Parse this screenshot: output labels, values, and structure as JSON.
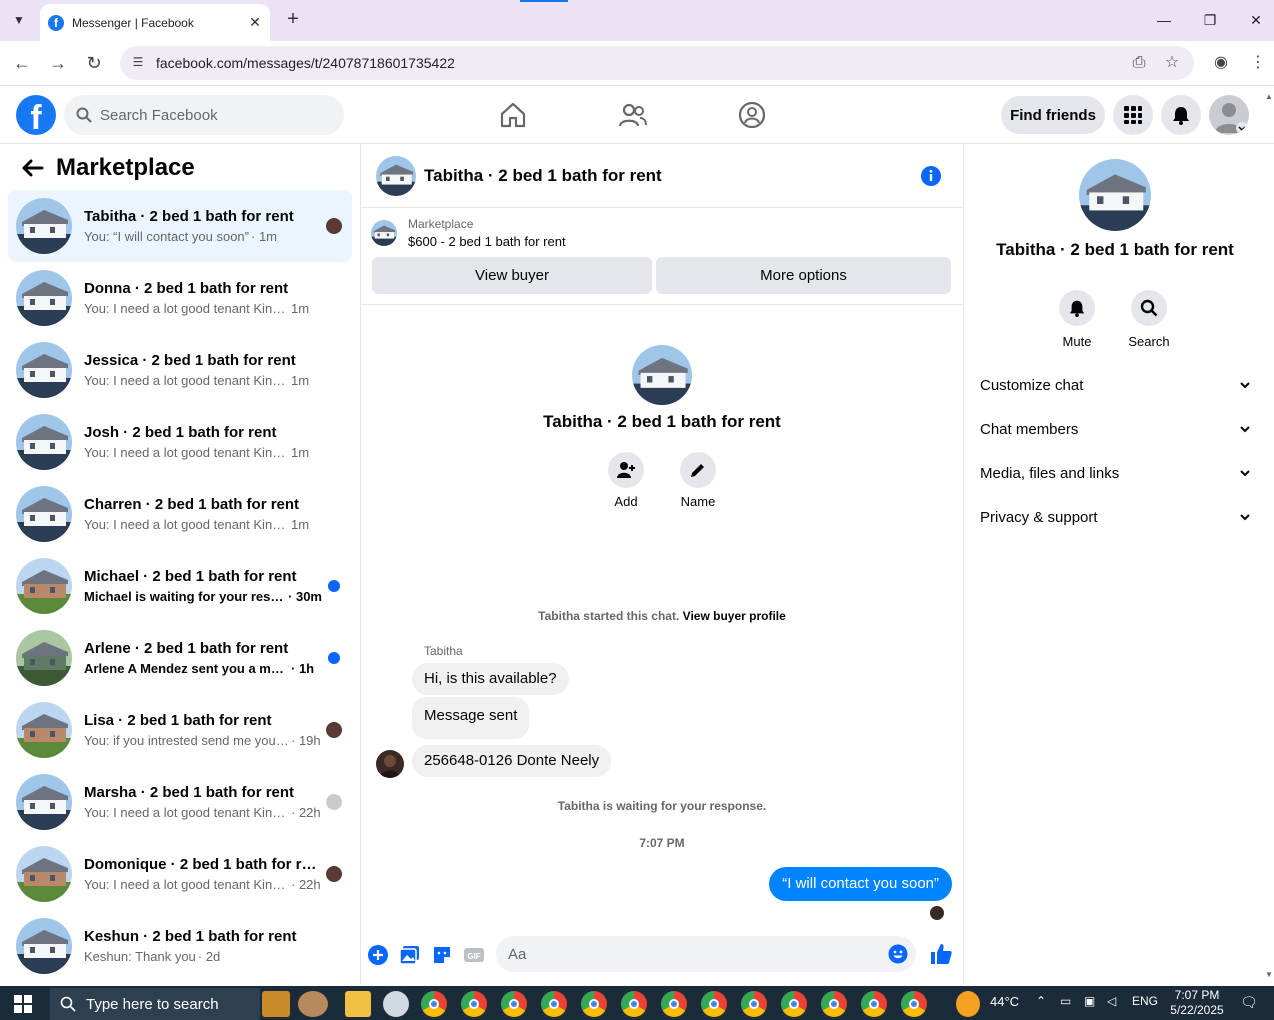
{
  "browser": {
    "tab_title": "Messenger | Facebook",
    "url": "facebook.com/messages/t/24078718601735422"
  },
  "fb": {
    "search_placeholder": "Search Facebook",
    "find_friends": "Find friends"
  },
  "left": {
    "title": "Marketplace",
    "conversations": [
      {
        "name": "Tabitha · 2 bed 1 bath for rent",
        "preview": "You: “I will contact you soon”",
        "time": "· 1m",
        "unread": false,
        "indicator": "seen",
        "thumb": "house-blue",
        "active": true
      },
      {
        "name": "Donna · 2 bed 1 bath for rent",
        "preview": "You: I need a lot good tenant Kindly s...",
        "time": "1m",
        "unread": false,
        "indicator": "none",
        "thumb": "house-blue",
        "active": false
      },
      {
        "name": "Jessica · 2 bed 1 bath for rent",
        "preview": "You: I need a lot good tenant Kindly s...",
        "time": "1m",
        "unread": false,
        "indicator": "none",
        "thumb": "house-blue",
        "active": false
      },
      {
        "name": "Josh · 2 bed 1 bath for rent",
        "preview": "You: I need a lot good tenant Kindly s...",
        "time": "1m",
        "unread": false,
        "indicator": "none",
        "thumb": "house-blue",
        "active": false
      },
      {
        "name": "Charren · 2 bed 1 bath for rent",
        "preview": "You: I need a lot good tenant Kindly s...",
        "time": "1m",
        "unread": false,
        "indicator": "none",
        "thumb": "house-blue",
        "active": false
      },
      {
        "name": "Michael · 2 bed 1 bath for rent",
        "preview": "Michael is waiting for your respo...",
        "time": "· 30m",
        "unread": true,
        "indicator": "dot",
        "thumb": "house-brick",
        "active": false
      },
      {
        "name": "Arlene · 2 bed 1 bath for rent",
        "preview": "Arlene A Mendez sent you a messa...",
        "time": "· 1h",
        "unread": true,
        "indicator": "dot",
        "thumb": "house-green",
        "active": false
      },
      {
        "name": "Lisa · 2 bed 1 bath for rent",
        "preview": "You: if you intrested send me your...",
        "time": "· 19h",
        "unread": false,
        "indicator": "seen",
        "thumb": "house-brick",
        "active": false
      },
      {
        "name": "Marsha · 2 bed 1 bath for rent",
        "preview": "You: I need a lot good tenant Kind...",
        "time": "· 22h",
        "unread": false,
        "indicator": "seen-grey",
        "thumb": "house-blue",
        "active": false
      },
      {
        "name": "Domonique · 2 bed 1 bath for rent",
        "preview": "You: I need a lot good tenant Kind...",
        "time": "· 22h",
        "unread": false,
        "indicator": "seen",
        "thumb": "house-brick",
        "active": false
      },
      {
        "name": "Keshun · 2 bed 1 bath for rent",
        "preview": "Keshun: Thank you",
        "time": "· 2d",
        "unread": false,
        "indicator": "none",
        "thumb": "house-blue",
        "active": false
      }
    ]
  },
  "chat": {
    "title": "Tabitha · 2 bed 1 bath for rent",
    "marketplace_label": "Marketplace",
    "listing": "$600 - 2 bed 1 bath for rent",
    "view_buyer": "View buyer",
    "more_options": "More options",
    "intro_name": "Tabitha · 2 bed 1 bath for rent",
    "add_label": "Add",
    "name_label": "Name",
    "started_text": "Tabitha started this chat.",
    "view_buyer_profile": "View buyer profile",
    "sender": "Tabitha",
    "messages_in": [
      "Hi, is this available?",
      "Message sent",
      "256648-0126 Donte Neely"
    ],
    "waiting_text": "Tabitha is waiting for your response.",
    "timestamp": "7:07 PM",
    "message_out": "“I will contact you soon”",
    "composer_placeholder": "Aa"
  },
  "right": {
    "name": "Tabitha · 2 bed 1 bath for rent",
    "mute": "Mute",
    "search": "Search",
    "sections": [
      "Customize chat",
      "Chat members",
      "Media, files and links",
      "Privacy & support"
    ]
  },
  "taskbar": {
    "search_placeholder": "Type here to search",
    "temp": "44°C",
    "lang": "ENG",
    "time": "7:07 PM",
    "date": "5/22/2025"
  },
  "colors": {
    "fb_blue": "#1877f2",
    "messenger_blue": "#0084ff",
    "active_row": "#ebf5ff"
  }
}
